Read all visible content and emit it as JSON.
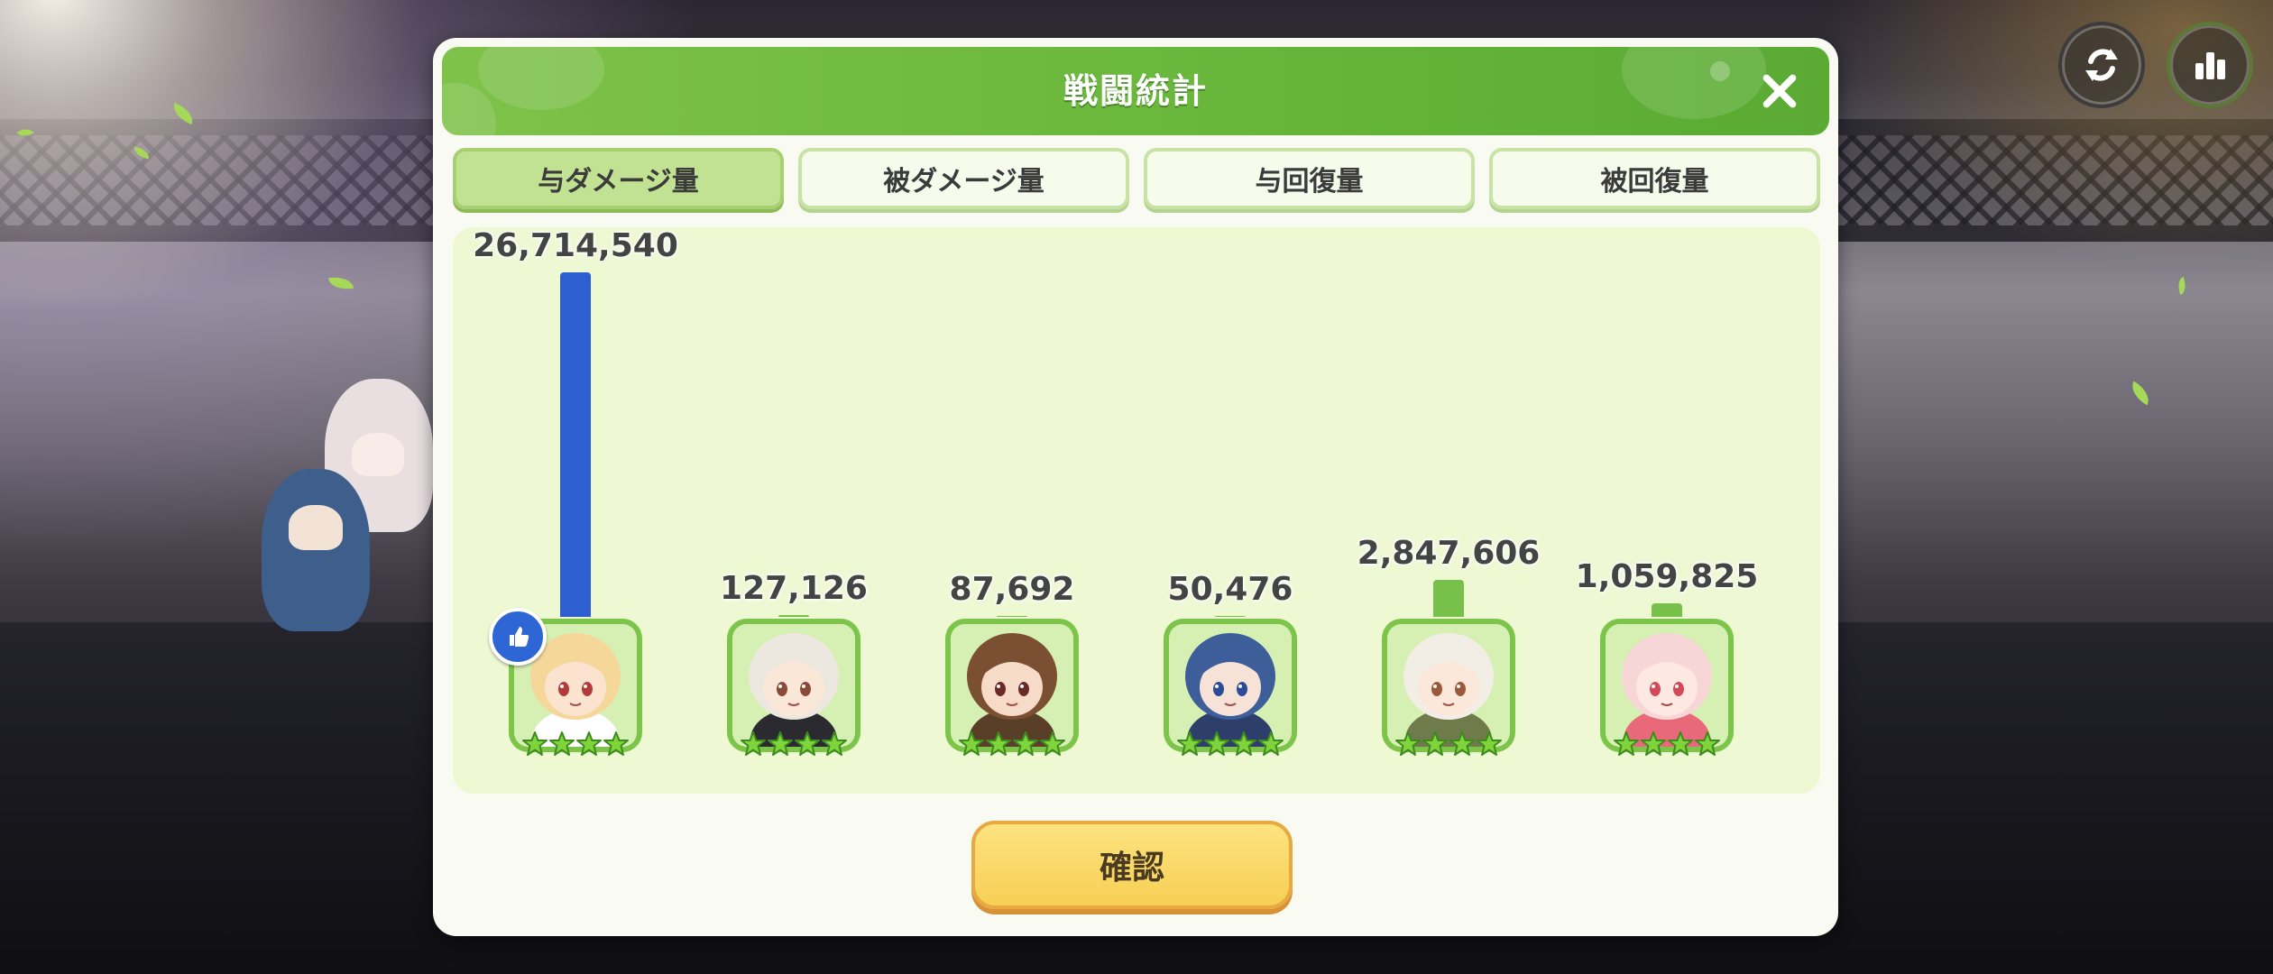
{
  "dialog": {
    "title": "戦闘統計",
    "close_icon": "close-icon",
    "confirm_label": "確認"
  },
  "tabs": [
    {
      "label": "与ダメージ量",
      "active": true
    },
    {
      "label": "被ダメージ量",
      "active": false
    },
    {
      "label": "与回復量",
      "active": false
    },
    {
      "label": "被回復量",
      "active": false
    }
  ],
  "chart_data": {
    "type": "bar",
    "title": "",
    "xlabel": "",
    "ylabel": "",
    "categories": [
      "char-1",
      "char-2",
      "char-3",
      "char-4",
      "char-5",
      "char-6"
    ],
    "values": [
      26714540,
      127126,
      87692,
      50476,
      2847606,
      1059825
    ],
    "value_labels": [
      "26,714,540",
      "127,126",
      "87,692",
      "50,476",
      "2,847,606",
      "1,059,825"
    ],
    "ylim": [
      0,
      26714540
    ],
    "bar_colors": [
      "#2d5fd0",
      "#77c04a",
      "#77c04a",
      "#77c04a",
      "#77c04a",
      "#77c04a"
    ],
    "star_count": [
      4,
      4,
      4,
      4,
      4,
      4
    ],
    "mvp_index": 0
  },
  "top_buttons": [
    {
      "icon": "refresh-icon"
    },
    {
      "icon": "bar-chart-icon"
    }
  ],
  "colors": {
    "header_green": "#6ab83c",
    "panel_bg": "#eef8d2",
    "bar_blue": "#2d5fd0",
    "confirm_yellow": "#f7cf55"
  }
}
